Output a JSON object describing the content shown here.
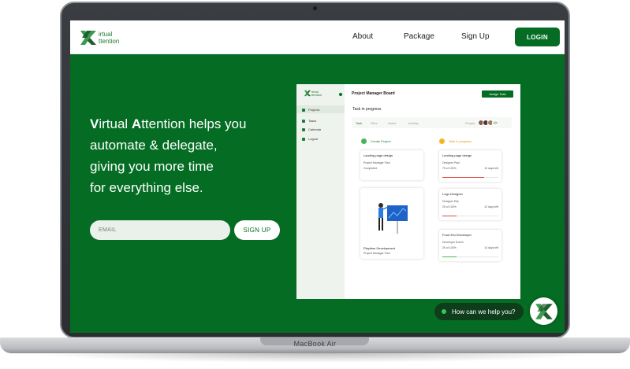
{
  "device": {
    "model_label": "MacBook Air"
  },
  "brand": {
    "name_line1": "irtual",
    "name_line2": "ttention",
    "primary_color": "#046d23",
    "accent_color": "#38c757"
  },
  "nav": {
    "links": [
      "About",
      "Package",
      "Sign Up"
    ],
    "login_label": "LOGIN"
  },
  "hero": {
    "lines": [
      {
        "bold1": "V",
        "text1": "irtual ",
        "bold2": "A",
        "text2": "ttention helps you"
      },
      {
        "text": "automate & delegate,"
      },
      {
        "text": "giving you more time"
      },
      {
        "text": "for everything else."
      }
    ],
    "email_placeholder": "EMAIL",
    "signup_label": "SIGN UP"
  },
  "dashboard": {
    "logo_line1": "irtual",
    "logo_line2": "ttention",
    "title": "Project Manager Board",
    "assign_label": "Assign Task",
    "sidebar": [
      "Projects",
      "Tasks",
      "Calendar",
      "Logout"
    ],
    "section": "Task in progress",
    "tabs": [
      "Task",
      "Files",
      "Notes",
      "Activity"
    ],
    "people_label": "People",
    "people_extra": "+20",
    "col1": "Create Project",
    "col2": "Task in progress",
    "col1_cards": [
      {
        "title": "Landing page design",
        "meta": "Project Manager  Paul",
        "sub": "Completed"
      },
      {
        "title": "Playtime Development",
        "meta": "Project Manager  Paul"
      }
    ],
    "col2_cards": [
      {
        "title": "Landing page design",
        "meta": "Designer   Paul",
        "pct": "75 of 100%",
        "days": "10 days left",
        "progress": 0.75
      },
      {
        "title": "Logo Designer",
        "meta": "Designer   Elly",
        "pct": "25 of 100%",
        "days": "12 days left",
        "progress": 0.25
      },
      {
        "title": "Front End Developer",
        "meta": "Developer  Dolvin",
        "pct": "25 of 100%",
        "days": "14 days left",
        "progress": 0.25
      }
    ]
  },
  "chat": {
    "prompt": "How can we help you?"
  }
}
